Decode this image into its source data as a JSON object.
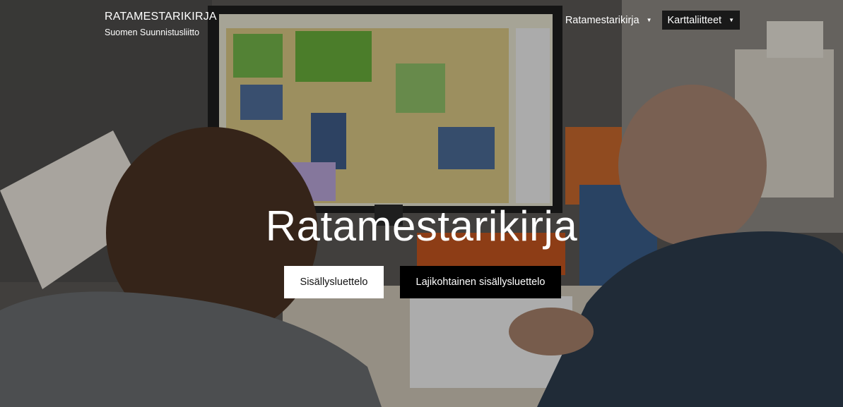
{
  "brand": {
    "title": "RATAMESTARIKIRJA",
    "subtitle": "Suomen Suunnistusliitto"
  },
  "nav": {
    "items": [
      {
        "label": "Ratamestarikirja",
        "caret": "▼"
      },
      {
        "label": "Karttaliitteet",
        "caret": "▼"
      }
    ]
  },
  "hero": {
    "title": "Ratamestarikirja",
    "buttons": {
      "primary": "Sisällysluettelo",
      "secondary": "Lajikohtainen sisällysluettelo"
    },
    "image_description": "photo-background"
  },
  "colors": {
    "button_dark": "#000000",
    "button_light": "#ffffff",
    "nav_active_bg": "#191919",
    "text": "#ffffff"
  }
}
